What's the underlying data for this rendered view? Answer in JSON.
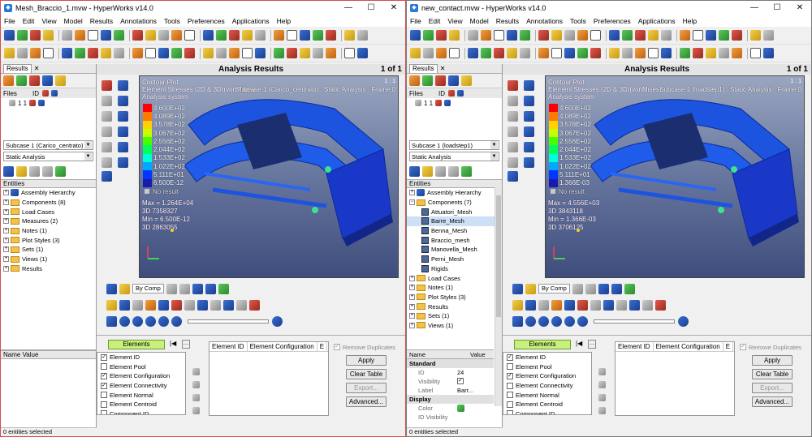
{
  "windows": [
    {
      "id": "left",
      "title": "Mesh_Braccio_1.mvw - HyperWorks v14.0",
      "menu": [
        "File",
        "Edit",
        "View",
        "Model",
        "Results",
        "Annotations",
        "Tools",
        "Preferences",
        "Applications",
        "Help"
      ],
      "results_tab": "Results",
      "files_label": "Files",
      "files_cols": "ID",
      "files_row": "1  1",
      "subcase_combo": "Subcase 1 (Carico_centrato)",
      "analysis_combo": "Static Analysis",
      "entities_header": "Entities",
      "tree": [
        {
          "pm": "+",
          "label": "Assembly Hierarchy",
          "kind": "asm"
        },
        {
          "pm": "+",
          "label": "Components (8)",
          "kind": "fold"
        },
        {
          "pm": "+",
          "label": "Load Cases",
          "kind": "fold"
        },
        {
          "pm": "+",
          "label": "Measures (2)",
          "kind": "fold"
        },
        {
          "pm": "+",
          "label": "Notes (1)",
          "kind": "fold"
        },
        {
          "pm": "+",
          "label": "Plot Styles (3)",
          "kind": "fold"
        },
        {
          "pm": "+",
          "label": "Sets (1)",
          "kind": "fold"
        },
        {
          "pm": "+",
          "label": "Views (1)",
          "kind": "fold"
        },
        {
          "pm": "+",
          "label": "Results",
          "kind": "fold"
        }
      ],
      "name_value_header": "Name Value",
      "analysis_results": "Analysis Results",
      "page": "1 of 1",
      "vp_page": "1 : 1",
      "contour_title": "Contour Plot",
      "contour_sub": "Element Stresses (2D & 3D)(vonMises)",
      "analysis_system": "Analysis system",
      "subcase_text": "Subcase 1 (Carico_centrato) : Static Analysis : Frame 0",
      "legend": [
        "4.600E+02",
        "4.089E+02",
        "3.578E+02",
        "3.067E+02",
        "2.556E+02",
        "2.044E+02",
        "1.533E+02",
        "1.022E+02",
        "5.111E+01",
        "6.500E-12"
      ],
      "no_result": "No result",
      "max_text": "Max = 1.264E+04",
      "max_id": "3D 7358327",
      "min_text": "Min = 6.500E-12",
      "min_id": "3D 2863055",
      "bycomp": "By Comp",
      "elements_btn": "Elements",
      "checklist": [
        {
          "label": "Element ID",
          "checked": true
        },
        {
          "label": "Element Pool",
          "checked": false
        },
        {
          "label": "Element Configuration",
          "checked": true
        },
        {
          "label": "Element Connectivity",
          "checked": true
        },
        {
          "label": "Element Normal",
          "checked": false
        },
        {
          "label": "Element Centroid",
          "checked": false
        },
        {
          "label": "Component ID",
          "checked": false
        }
      ],
      "table_cols": [
        "Element ID",
        "Element Configuration",
        "E"
      ],
      "remove_dup": "Remove Duplicates",
      "btn_apply": "Apply",
      "btn_clear": "Clear Table",
      "btn_export": "Export...",
      "btn_advanced": "Advanced...",
      "status": "0 entities selected"
    },
    {
      "id": "right",
      "title": "new_contact.mvw - HyperWorks v14.0",
      "menu": [
        "File",
        "Edit",
        "View",
        "Model",
        "Results",
        "Annotations",
        "Tools",
        "Preferences",
        "Applications",
        "Help"
      ],
      "results_tab": "Results",
      "files_label": "Files",
      "files_cols": "ID",
      "files_row": "1  1",
      "subcase_combo": "Subcase 1 (loadstep1)",
      "analysis_combo": "Static Analysis",
      "entities_header": "Entities",
      "tree": [
        {
          "pm": "+",
          "label": "Assembly Hierarchy",
          "kind": "asm"
        },
        {
          "pm": "−",
          "label": "Components (7)",
          "kind": "fold"
        },
        {
          "pm": "",
          "label": "Attuatori_Mesh",
          "kind": "comp"
        },
        {
          "pm": "",
          "label": "Barre_Mesh",
          "kind": "comp",
          "sel": true
        },
        {
          "pm": "",
          "label": "Benna_Mesh",
          "kind": "comp"
        },
        {
          "pm": "",
          "label": "Braccio_mesh",
          "kind": "comp"
        },
        {
          "pm": "",
          "label": "Manovella_Mesh",
          "kind": "comp"
        },
        {
          "pm": "",
          "label": "Perni_Mesh",
          "kind": "comp"
        },
        {
          "pm": "",
          "label": "Rigids",
          "kind": "comp"
        },
        {
          "pm": "+",
          "label": "Load Cases",
          "kind": "fold"
        },
        {
          "pm": "+",
          "label": "Notes (1)",
          "kind": "fold"
        },
        {
          "pm": "+",
          "label": "Plot Styles (3)",
          "kind": "fold"
        },
        {
          "pm": "+",
          "label": "Results",
          "kind": "fold"
        },
        {
          "pm": "+",
          "label": "Sets (1)",
          "kind": "fold"
        },
        {
          "pm": "+",
          "label": "Views (1)",
          "kind": "fold"
        }
      ],
      "name_header": "Name",
      "value_header": "Value",
      "props": {
        "standard": "Standard",
        "id_label": "ID",
        "id_value": "24",
        "vis_label": "Visibility",
        "label_label": "Label",
        "label_value": "Barr...",
        "display": "Display",
        "color_label": "Color",
        "idvis_label": "ID Visibility"
      },
      "analysis_results": "Analysis Results",
      "page": "1 of 1",
      "vp_page": "1 : 1",
      "contour_title": "Contour Plot",
      "contour_sub": "Element Stresses (2D & 3D)(vonMises)",
      "analysis_system": "Analysis system",
      "subcase_text": "Subcase 1 (loadstep1) : Static Analysis : Frame 0",
      "legend": [
        "4.600E+02",
        "4.089E+02",
        "3.578E+02",
        "3.067E+02",
        "2.556E+02",
        "2.044E+02",
        "1.533E+02",
        "1.022E+02",
        "5.111E+01",
        "1.366E-03"
      ],
      "no_result": "No result",
      "max_text": "Max = 4.556E+03",
      "max_id": "3D 3843118",
      "min_text": "Min = 1.366E-03",
      "min_id": "3D 3706125",
      "bycomp": "By Comp",
      "elements_btn": "Elements",
      "checklist": [
        {
          "label": "Element ID",
          "checked": true
        },
        {
          "label": "Element Pool",
          "checked": false
        },
        {
          "label": "Element Configuration",
          "checked": true
        },
        {
          "label": "Element Connectivity",
          "checked": false
        },
        {
          "label": "Element Normal",
          "checked": false
        },
        {
          "label": "Element Centroid",
          "checked": false
        },
        {
          "label": "Component ID",
          "checked": false
        }
      ],
      "table_cols": [
        "Element ID",
        "Element Configuration",
        "E"
      ],
      "remove_dup": "Remove Duplicates",
      "btn_apply": "Apply",
      "btn_clear": "Clear Table",
      "btn_export": "Export...",
      "btn_advanced": "Advanced...",
      "status": "0 entities selected"
    }
  ],
  "legend_colors": [
    "#ff0000",
    "#ff7a00",
    "#ffd200",
    "#c8ff00",
    "#48ff00",
    "#00ff5a",
    "#00ffd8",
    "#00a8ff",
    "#0036ff",
    "#1a1aa8"
  ]
}
